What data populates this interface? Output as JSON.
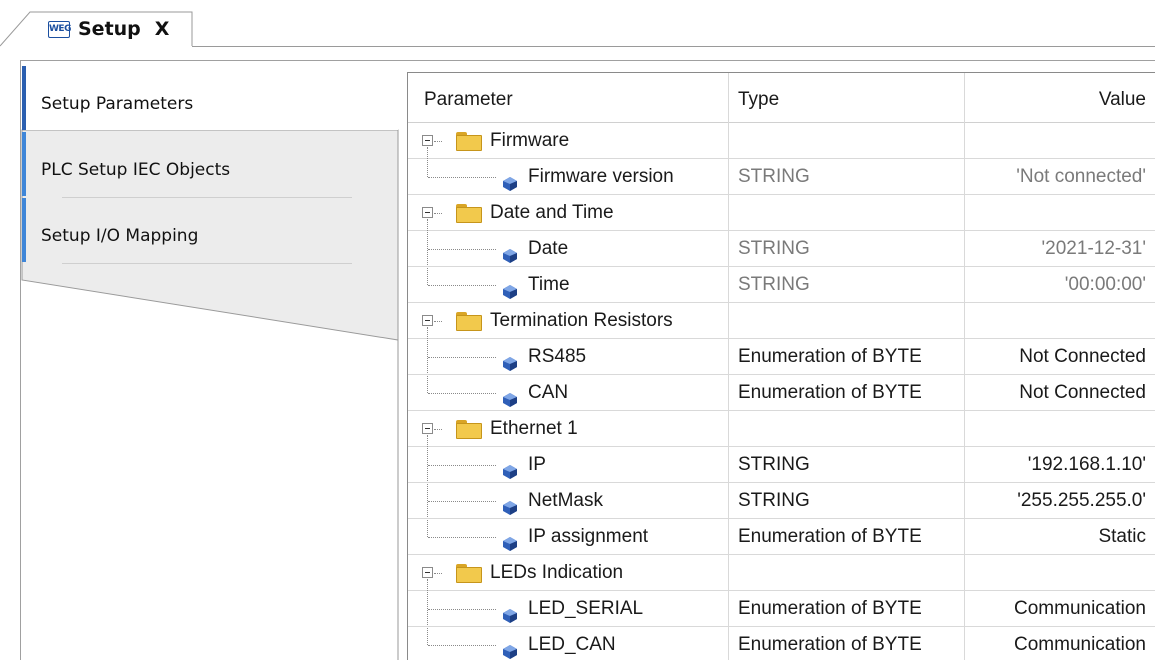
{
  "document_tab": {
    "logo_text": "WEG",
    "title": "Setup",
    "close_glyph": "X"
  },
  "side_tabs": [
    {
      "label": "Setup Parameters",
      "active": true
    },
    {
      "label": "PLC Setup IEC Objects",
      "active": false
    },
    {
      "label": "Setup I/O Mapping",
      "active": false
    }
  ],
  "grid": {
    "columns": {
      "parameter": "Parameter",
      "type": "Type",
      "value": "Value"
    },
    "groups": [
      {
        "name": "Firmware",
        "items": [
          {
            "name": "Firmware version",
            "type": "STRING",
            "value": "'Not connected'",
            "muted": true
          }
        ]
      },
      {
        "name": "Date and Time",
        "items": [
          {
            "name": "Date",
            "type": "STRING",
            "value": "'2021-12-31'",
            "muted": true
          },
          {
            "name": "Time",
            "type": "STRING",
            "value": "'00:00:00'",
            "muted": true
          }
        ]
      },
      {
        "name": "Termination Resistors",
        "items": [
          {
            "name": "RS485",
            "type": "Enumeration of BYTE",
            "value": "Not Connected",
            "muted": false
          },
          {
            "name": "CAN",
            "type": "Enumeration of BYTE",
            "value": "Not Connected",
            "muted": false
          }
        ]
      },
      {
        "name": "Ethernet 1",
        "items": [
          {
            "name": "IP",
            "type": "STRING",
            "value": "'192.168.1.10'",
            "muted": false
          },
          {
            "name": "NetMask",
            "type": "STRING",
            "value": "'255.255.255.0'",
            "muted": false
          },
          {
            "name": "IP assignment",
            "type": "Enumeration of BYTE",
            "value": "Static",
            "muted": false
          }
        ]
      },
      {
        "name": "LEDs Indication",
        "items": [
          {
            "name": "LED_SERIAL",
            "type": "Enumeration of BYTE",
            "value": "Communication",
            "muted": false
          },
          {
            "name": "LED_CAN",
            "type": "Enumeration of BYTE",
            "value": "Communication",
            "muted": false
          }
        ]
      }
    ]
  },
  "icons": {
    "group": "folder-icon",
    "item": "parameter-icon",
    "toggle": "collapse-icon"
  },
  "colors": {
    "accent": "#2b5fb0",
    "inactive_tab": "#ececec",
    "muted_text": "#7a7a7a",
    "folder": "#f2c94c"
  }
}
